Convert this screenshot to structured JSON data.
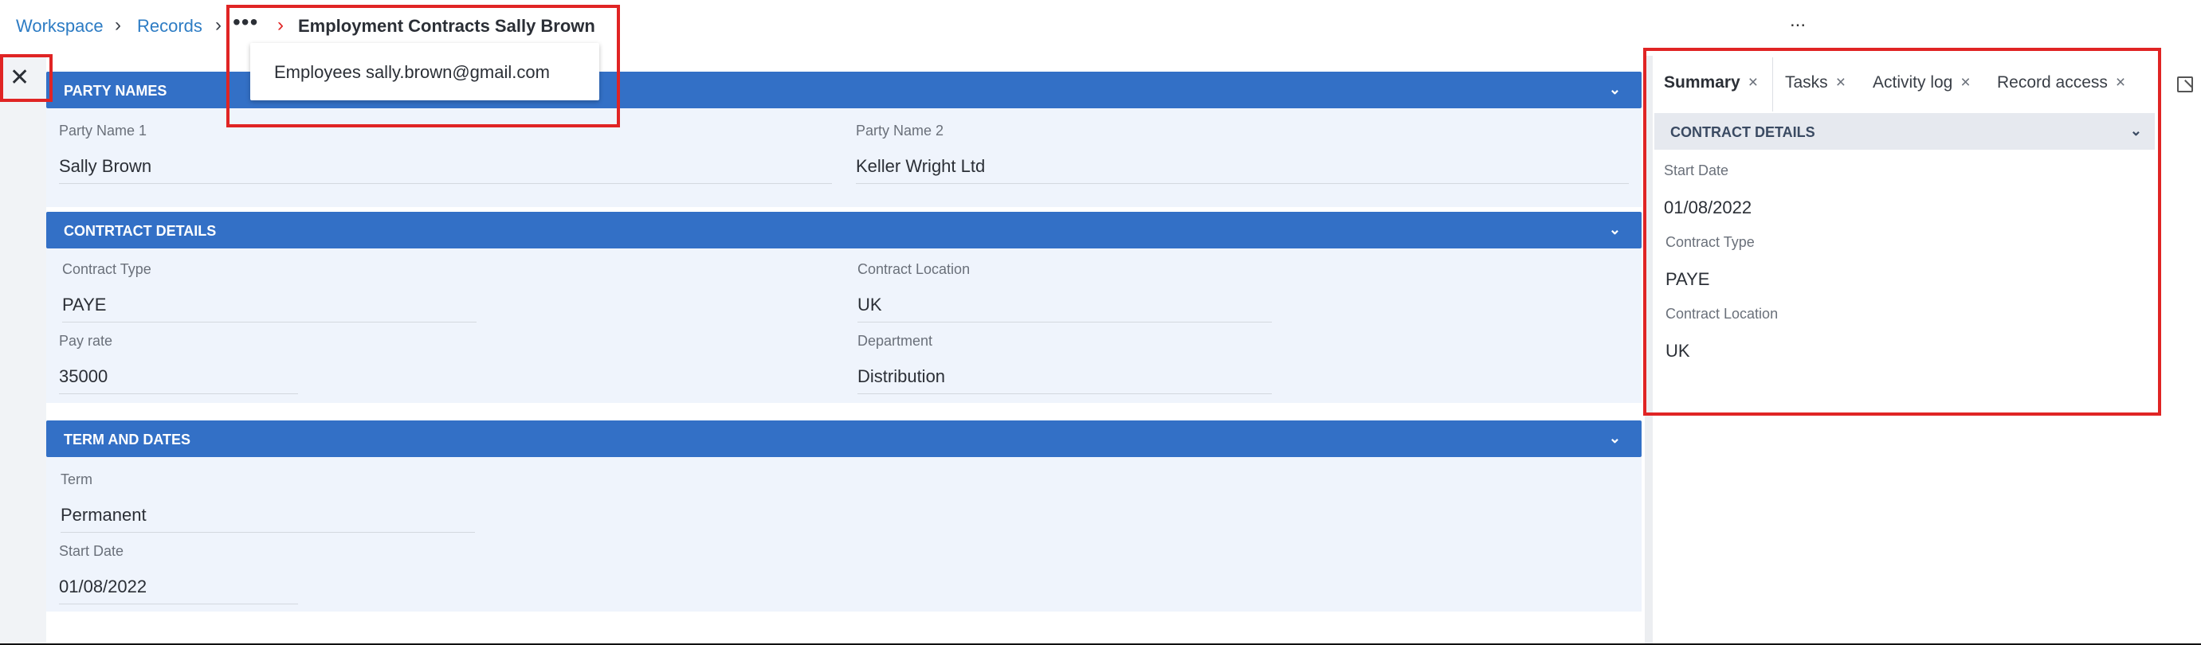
{
  "breadcrumb": {
    "items": [
      "Workspace",
      "Records"
    ],
    "ellipsis": "•••",
    "current": "Employment Contracts Sally Brown",
    "dropdown_item": "Employees sally.brown@gmail.com"
  },
  "header": {
    "more_label": "..."
  },
  "close_label": "✕",
  "sections": [
    {
      "title": "PARTY NAMES",
      "fields": [
        {
          "label": "Party Name 1",
          "value": "Sally Brown"
        },
        {
          "label": "Party Name 2",
          "value": "Keller Wright Ltd"
        }
      ]
    },
    {
      "title": "CONTRTACT DETAILS",
      "fields": [
        {
          "label": "Contract Type",
          "value": "PAYE"
        },
        {
          "label": "Contract Location",
          "value": "UK"
        },
        {
          "label": "Pay rate",
          "value": "35000"
        },
        {
          "label": "Department",
          "value": "Distribution"
        }
      ]
    },
    {
      "title": "TERM AND DATES",
      "fields": [
        {
          "label": "Term",
          "value": "Permanent"
        },
        {
          "label": "Start Date",
          "value": "01/08/2022"
        }
      ]
    }
  ],
  "right_panel": {
    "tabs": [
      {
        "label": "Summary"
      },
      {
        "label": "Tasks"
      },
      {
        "label": "Activity log"
      },
      {
        "label": "Record access"
      }
    ],
    "tab_close": "×",
    "section_title": "CONTRACT DETAILS",
    "fields": [
      {
        "label": "Start Date",
        "value": "01/08/2022"
      },
      {
        "label": "Contract Type",
        "value": "PAYE"
      },
      {
        "label": "Contract Location",
        "value": "UK"
      }
    ]
  },
  "icons": {
    "chevron_right": "chevron-right-icon",
    "chevron_down": "chevron-down-icon",
    "close": "close-icon",
    "popout": "popout-icon"
  },
  "colors": {
    "accent": "#3370c6",
    "section_body": "#eff4fc",
    "link": "#2d7cc4",
    "highlight": "#e02424"
  }
}
